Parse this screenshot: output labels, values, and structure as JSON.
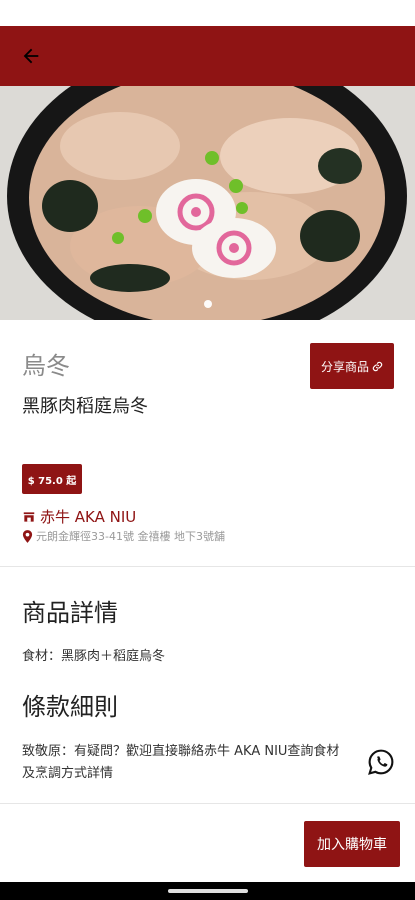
{
  "header": {
    "back_icon": "arrow-left-icon"
  },
  "hero": {
    "image_count": 1,
    "active_index": 0
  },
  "product": {
    "category": "烏冬",
    "name": "黑豚肉稻庭烏冬",
    "price": "$ 75.0 起",
    "share_label": "分享商品",
    "share_icon": "link-icon"
  },
  "shop": {
    "name": "赤牛 AKA NIU",
    "address": "元朗金輝徑33-41號 金禧樓 地下3號舖",
    "shop_icon": "storefront-icon",
    "pin_icon": "location-pin-icon"
  },
  "details": {
    "title": "商品詳情",
    "ingredients": "食材：黑豚肉＋稻庭烏冬"
  },
  "terms": {
    "title": "條款細則",
    "line1": "致敬原：有疑問？歡迎直接聯絡赤牛 AKA NIU查詢食材",
    "line2": "及烹調方式詳情"
  },
  "footer": {
    "add_to_cart": "加入購物車"
  },
  "colors": {
    "brand": "#8f1414",
    "muted_text": "#8a8a8a"
  }
}
